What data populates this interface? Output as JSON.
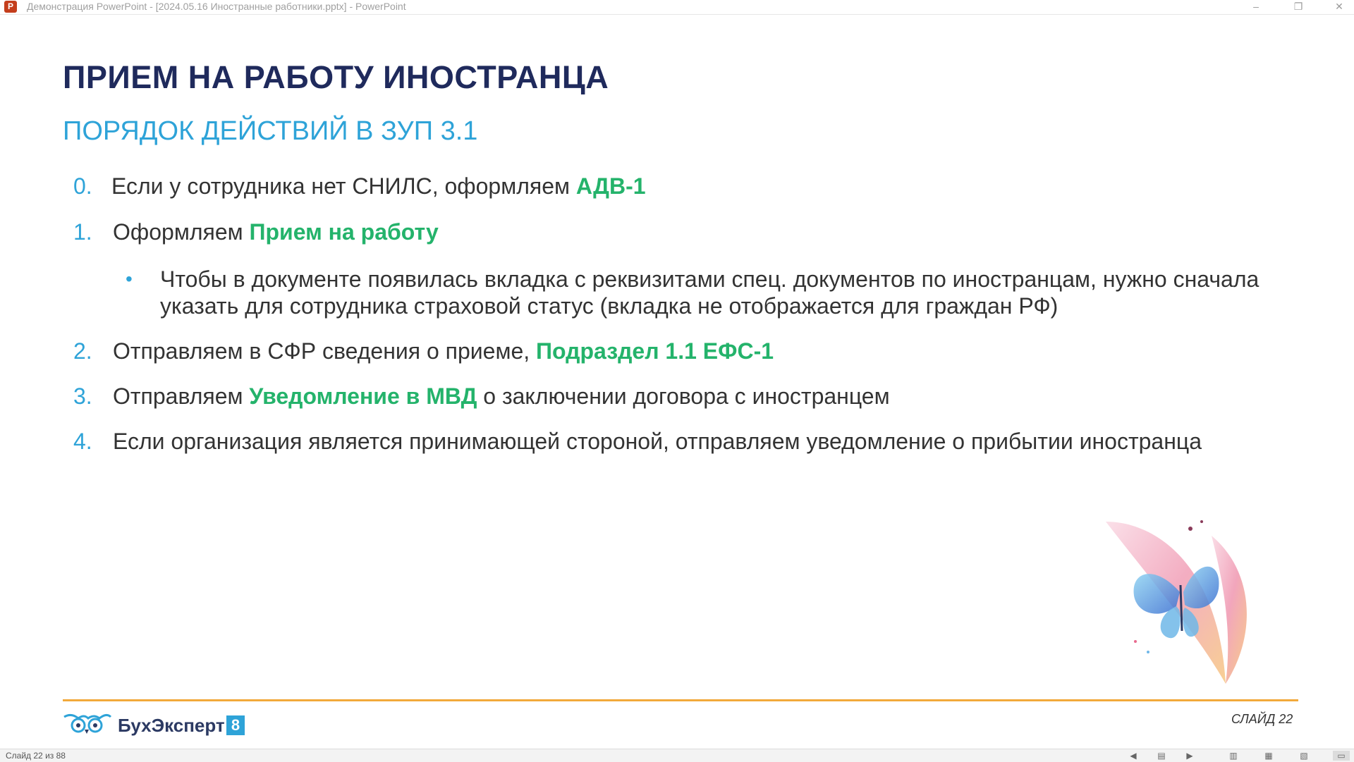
{
  "window": {
    "title": "Демонстрация PowerPoint - [2024.05.16 Иностранные работники.pptx] - PowerPoint",
    "app_icon": "P",
    "controls": {
      "minimize": "–",
      "restore": "❐",
      "close": "✕"
    }
  },
  "slide": {
    "title": "ПРИЕМ НА РАБОТУ ИНОСТРАНЦА",
    "subtitle": "ПОРЯДОК ДЕЙСТВИЙ В ЗУП 3.1",
    "steps": [
      {
        "num": "0.",
        "pre": "Если у сотрудника нет СНИЛС, оформляем ",
        "hl": "АДВ-1",
        "post": ""
      },
      {
        "num": "1.",
        "pre": "Оформляем ",
        "hl": "Прием на работу",
        "post": ""
      },
      {
        "num": "2.",
        "pre": "Отправляем в СФР сведения о приеме, ",
        "hl": "Подраздел 1.1 ЕФС-1",
        "post": ""
      },
      {
        "num": "3.",
        "pre": "Отправляем ",
        "hl": "Уведомление в МВД",
        "post": " о заключении договора с иностранцем"
      },
      {
        "num": "4.",
        "pre": "Если организация является принимающей стороной, отправляем уведомление о прибытии иностранца",
        "hl": "",
        "post": ""
      }
    ],
    "bullet": {
      "marker": "•",
      "text": "Чтобы в документе появилась вкладка с реквизитами спец. документов по иностранцам, нужно сначала указать для сотрудника страховой статус (вкладка не отображается для граждан РФ)"
    },
    "footer": {
      "logo_text": "БухЭксперт",
      "logo_badge": "8",
      "slide_label": "СЛАЙД 22"
    },
    "decoration": "butterfly-feather-icon"
  },
  "statusbar": {
    "text": "Слайд 22 из 88"
  },
  "colors": {
    "title": "#1f2a5c",
    "accent_blue": "#2ea3d8",
    "highlight_green": "#24b36b",
    "footer_line": "#f2a93b"
  }
}
